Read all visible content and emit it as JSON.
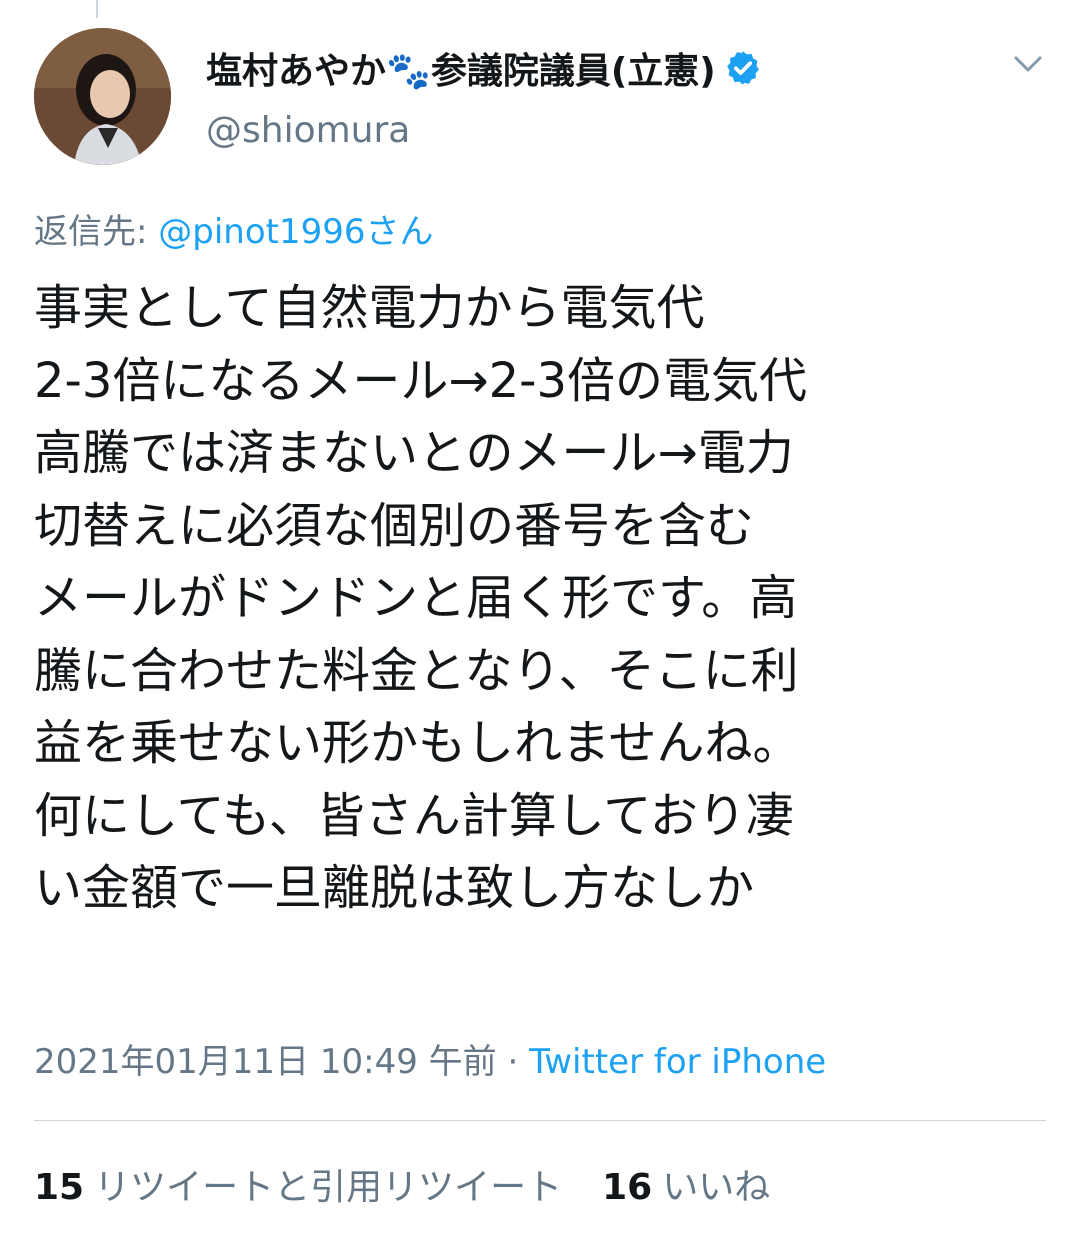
{
  "tweet": {
    "display_name": "塩村あやか🐾参議院議員(立憲)",
    "handle": "@shiomura",
    "reply_prefix": "返信先: ",
    "reply_mention": "@pinot1996さん",
    "text": "事実として自然電力から電気代\n2-3倍になるメール→2-3倍の電気代\n高騰では済まないとのメール→電力\n切替えに必須な個別の番号を含む\nメールがドンドンと届く形です。高\n騰に合わせた料金となり、そこに利\n益を乗せない形かもしれませんね。\n何にしても、皆さん計算しており凄\nい金額で一旦離脱は致し方なしか",
    "timestamp": "2021年01月11日 10:49 午前",
    "separator": " · ",
    "source": "Twitter for iPhone"
  },
  "stats": {
    "retweets_count": "15",
    "retweets_label": "リツイートと引用リツイート",
    "likes_count": "16",
    "likes_label": "いいね"
  },
  "icons": {
    "verified": "verified-badge-icon",
    "caret": "chevron-down-icon",
    "avatar": "profile-avatar"
  },
  "colors": {
    "accent": "#1da1f2",
    "secondary_text": "#657786",
    "primary_text": "#14171a",
    "divider": "#ccd6dd"
  }
}
